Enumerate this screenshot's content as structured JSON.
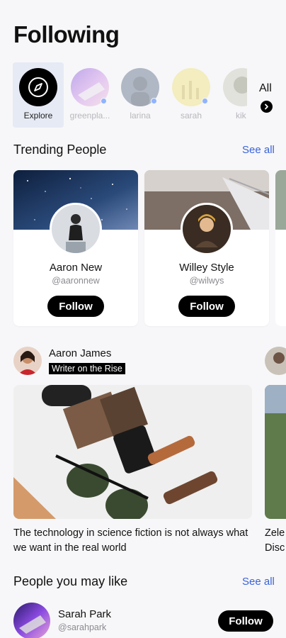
{
  "header": {
    "title": "Following"
  },
  "stories": {
    "items": [
      {
        "label": "Explore",
        "icon": "compass-icon"
      },
      {
        "label": "greenpla..."
      },
      {
        "label": "larina"
      },
      {
        "label": "sarah"
      },
      {
        "label": "kik"
      }
    ],
    "all_label": "All"
  },
  "trending": {
    "title": "Trending People",
    "see_all": "See all",
    "people": [
      {
        "name": "Aaron New",
        "handle": "@aaronnew",
        "follow": "Follow"
      },
      {
        "name": "Willey Style",
        "handle": "@wilwys",
        "follow": "Follow"
      }
    ]
  },
  "post": {
    "author": "Aaron James",
    "badge": "Writer on the Rise",
    "caption": "The technology in science fiction is not always what we want in the real world",
    "peek_caption_line1": "Zele",
    "peek_caption_line2": "Disc"
  },
  "people_like": {
    "title": "People you may like",
    "see_all": "See all",
    "items": [
      {
        "name": "Sarah Park",
        "handle": "@sarahpark",
        "follow": "Follow"
      }
    ]
  },
  "colors": {
    "accent": "#3a63d8",
    "explore_bg": "#e6eaf5",
    "button": "#000000"
  }
}
